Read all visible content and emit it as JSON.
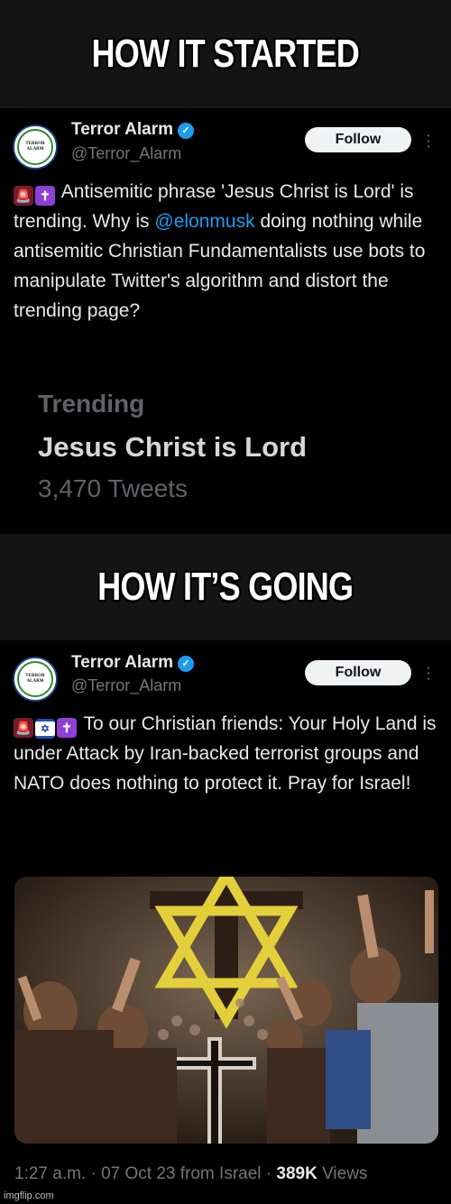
{
  "captions": {
    "top": "HOW IT STARTED",
    "middle": "HOW IT’S GOING"
  },
  "tweet1": {
    "name": "Terror Alarm",
    "handle": "@Terror_Alarm",
    "follow_label": "Follow",
    "avatar_text": [
      "TERROR",
      "ALARM"
    ],
    "emojis": [
      "siren-emoji",
      "latin-cross-emoji"
    ],
    "text_before_link": "Antisemitic phrase 'Jesus Christ is Lord' is trending. Why is ",
    "link": "@elonmusk",
    "text_after_link": " doing nothing while antisemitic Christian Fundamentalists use bots to manipulate Twitter's algorithm and distort the trending page?",
    "trending": {
      "label": "Trending",
      "topic": "Jesus Christ is Lord",
      "count": "3,470 Tweets"
    }
  },
  "tweet2": {
    "name": "Terror Alarm",
    "handle": "@Terror_Alarm",
    "follow_label": "Follow",
    "avatar_text": [
      "TERROR",
      "ALARM"
    ],
    "emojis": [
      "siren-emoji",
      "israel-flag-emoji",
      "latin-cross-emoji"
    ],
    "text": "To our Christian friends: Your Holy Land is under Attack by Iran-backed terrorist groups and NATO does nothing to protect it. Pray for Israel!",
    "meta_prefix": "1:27 a.m. · 07 Oct 23 from Israel · ",
    "views_count": "389K",
    "views_label": " Views"
  },
  "watermark": "imgflip.com",
  "colors": {
    "link": "#1d9bf0",
    "verified": "#1d9bf0",
    "star": "#e3cf3a"
  }
}
